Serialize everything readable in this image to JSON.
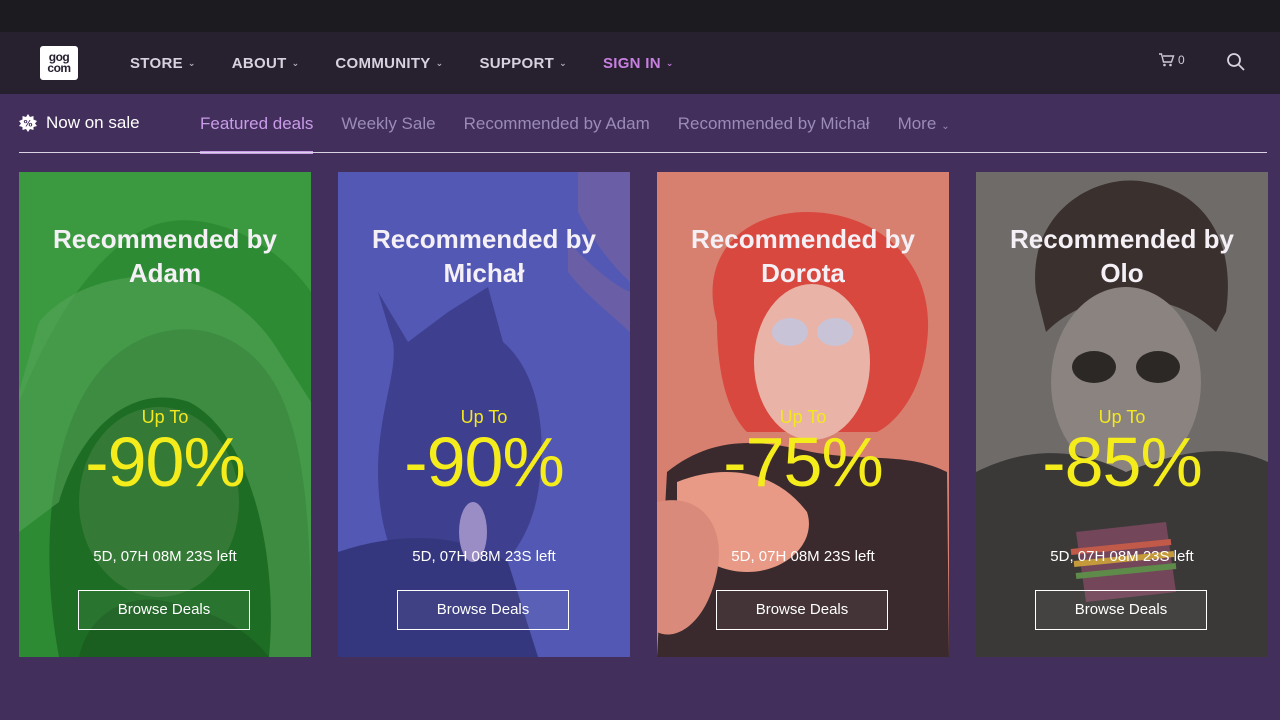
{
  "nav": {
    "logo_top": "gog",
    "logo_bottom": "com",
    "items": [
      {
        "label": "STORE"
      },
      {
        "label": "ABOUT"
      },
      {
        "label": "COMMUNITY"
      },
      {
        "label": "SUPPORT"
      },
      {
        "label": "SIGN IN"
      }
    ],
    "cart_count": "0"
  },
  "subnav": {
    "sale_label": "Now on sale",
    "tabs": [
      {
        "label": "Featured deals",
        "active": true
      },
      {
        "label": "Weekly Sale"
      },
      {
        "label": "Recommended by Adam"
      },
      {
        "label": "Recommended by Michał"
      },
      {
        "label": "More"
      }
    ]
  },
  "cards": [
    {
      "title": "Recommended by Adam",
      "up_to": "Up To",
      "discount": "-90%",
      "time_left": "5D, 07H 08M 23S left",
      "button": "Browse Deals",
      "tint": "#2a8a2f"
    },
    {
      "title": "Recommended by Michał",
      "up_to": "Up To",
      "discount": "-90%",
      "time_left": "5D, 07H 08M 23S left",
      "button": "Browse Deals",
      "tint": "#5155b0"
    },
    {
      "title": "Recommended by Dorota",
      "up_to": "Up To",
      "discount": "-75%",
      "time_left": "5D, 07H 08M 23S left",
      "button": "Browse Deals",
      "tint": "#d97a6c"
    },
    {
      "title": "Recommended by Olo",
      "up_to": "Up To",
      "discount": "-85%",
      "time_left": "5D, 07H 08M 23S left",
      "button": "Browse Deals",
      "tint": "#6f6b6b"
    }
  ],
  "colors": {
    "background": "#432f5c",
    "navbar": "#26202f",
    "accent": "#c99be8",
    "discount_yellow": "#f5ec1c"
  }
}
